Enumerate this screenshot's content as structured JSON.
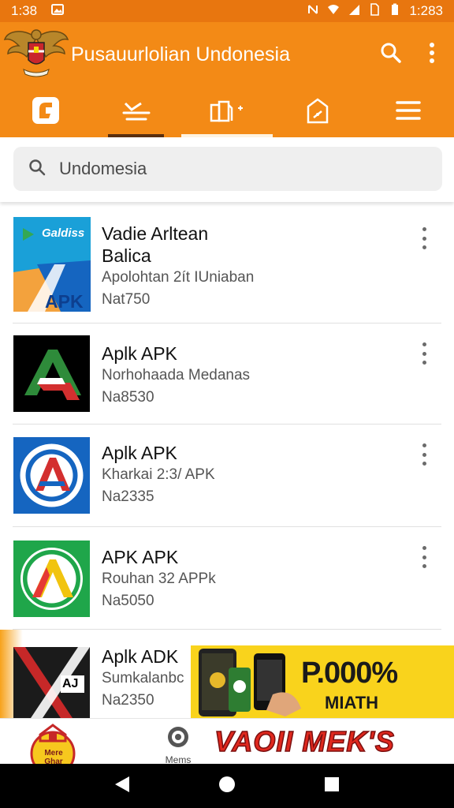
{
  "status_bar": {
    "time_left": "1:38",
    "time_right": "1:283"
  },
  "app_bar": {
    "title": "Pusauurlolian Undonesia"
  },
  "search": {
    "value": "Undomesia"
  },
  "list": [
    {
      "title": "Vadie Arltean",
      "title2": "Balica",
      "sub1": "Apolohtan 2ít IUniaban",
      "sub2": "Nat750",
      "thumb_text": "Galdiss",
      "thumb_label": "APK"
    },
    {
      "title": "Aplk APK",
      "sub1": "Norhohaada Medanas",
      "sub2": "Na8530"
    },
    {
      "title": "Aplk APK",
      "sub1": "Kharkai 2:3/ APK",
      "sub2": "Na2335"
    },
    {
      "title": "APK APK",
      "sub1": "Rouhan 32 APPk",
      "sub2": "Na5050"
    },
    {
      "title": "Aplk ADK",
      "sub1": "Sumkalanbc",
      "sub2": "Na2350",
      "thumb_text": "AJ"
    }
  ],
  "ad": {
    "headline": "P.000%",
    "subline": "MIATH"
  },
  "bottom_nav": {
    "center_label": "Mems",
    "banner_text": "VAOII MEK'S",
    "logo_text": "Mere Ghar"
  },
  "colors": {
    "primary": "#f38a16",
    "status": "#e8760f",
    "tab_indicator": "#5a2f0e"
  }
}
